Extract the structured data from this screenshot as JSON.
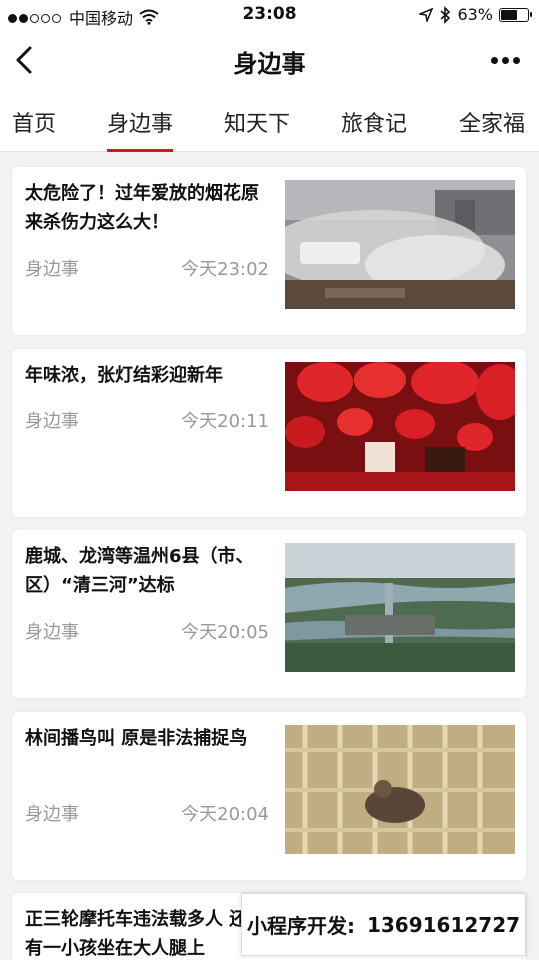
{
  "status_bar": {
    "carrier": "中国移动",
    "time": "23:08",
    "battery": "63%",
    "battery_level": 0.63,
    "signal_bars_filled": 2,
    "signal_bars_total": 5
  },
  "nav": {
    "title": "身边事",
    "back_icon": "chevron-left-icon",
    "more_icon": "ellipsis-icon"
  },
  "tabs": [
    {
      "label": "首页",
      "active": false
    },
    {
      "label": "身边事",
      "active": true
    },
    {
      "label": "知天下",
      "active": false
    },
    {
      "label": "旅食记",
      "active": false
    },
    {
      "label": "全家福",
      "active": false
    }
  ],
  "accent_color": "#c91d21",
  "articles": [
    {
      "title": "太危险了！过年爱放的烟花原来杀伤力这么大！",
      "source": "身边事",
      "time": "今天23:02"
    },
    {
      "title": "年味浓，张灯结彩迎新年",
      "source": "身边事",
      "time": "今天20:11"
    },
    {
      "title": "鹿城、龙湾等温州6县（市、区）“清三河”达标",
      "source": "身边事",
      "time": "今天20:05"
    },
    {
      "title": "林间播鸟叫 原是非法捕捉鸟",
      "source": "身边事",
      "time": "今天20:04"
    },
    {
      "title": "正三轮摩托车违法载多人 还有一小孩坐在大人腿上",
      "source": "身边事",
      "time": ""
    }
  ],
  "banner": {
    "label": "小程序开发:",
    "phone": "13691612727"
  }
}
